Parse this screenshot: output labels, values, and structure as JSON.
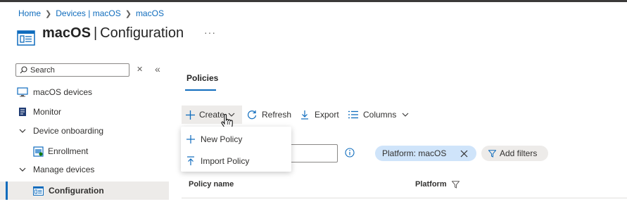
{
  "breadcrumb": {
    "items": [
      "Home",
      "Devices | macOS",
      "macOS"
    ]
  },
  "title": {
    "bold": "macOS",
    "rest": "Configuration",
    "more": "···"
  },
  "sidebar": {
    "search_placeholder": "Search",
    "items": [
      {
        "label": "macOS devices"
      },
      {
        "label": "Monitor"
      },
      {
        "label": "Device onboarding"
      },
      {
        "label": "Enrollment"
      },
      {
        "label": "Manage devices"
      },
      {
        "label": "Configuration"
      }
    ]
  },
  "main": {
    "tab": "Policies",
    "toolbar": {
      "create": "Create",
      "refresh": "Refresh",
      "export": "Export",
      "columns": "Columns"
    },
    "create_menu": [
      "New Policy",
      "Import Policy"
    ],
    "filter": {
      "pill": "Platform: macOS",
      "add_filters": "Add filters"
    },
    "table": {
      "columns": [
        "Policy name",
        "Platform"
      ]
    }
  },
  "colors": {
    "accent": "#0f6cbd",
    "pill_bg": "#cfe4fa",
    "hover_bg": "#edebe9"
  }
}
